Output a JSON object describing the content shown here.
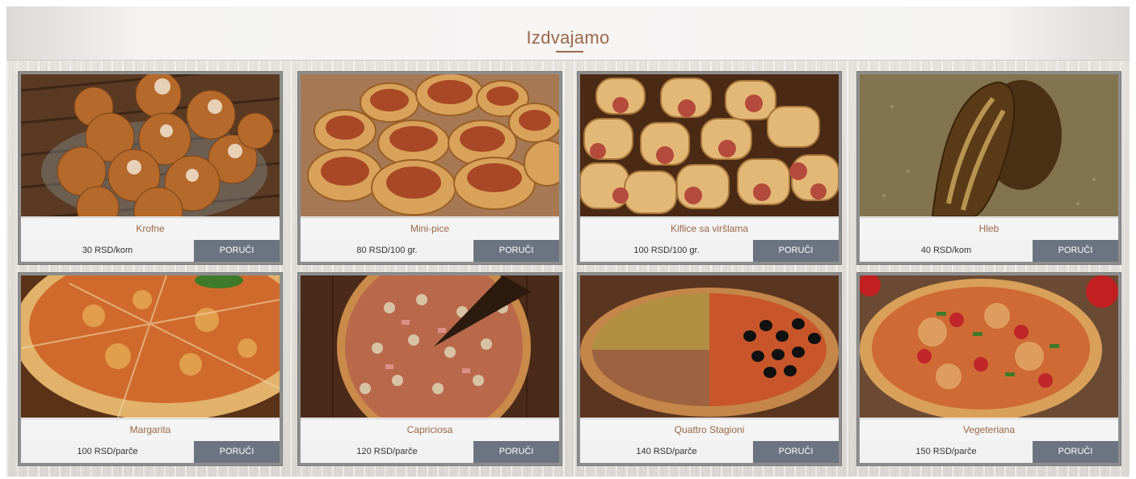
{
  "section": {
    "title": "Izdvajamo"
  },
  "products": [
    {
      "name": "Krofne",
      "price": "30 RSD/kom",
      "order_label": "PORUČI"
    },
    {
      "name": "Mini-pice",
      "price": "80 RSD/100 gr.",
      "order_label": "PORUČI"
    },
    {
      "name": "Kiflice sa viršlama",
      "price": "100 RSD/100 gr.",
      "order_label": "PORUČI"
    },
    {
      "name": "Hleb",
      "price": "40 RSD/kom",
      "order_label": "PORUČI"
    },
    {
      "name": "Margarita",
      "price": "100 RSD/parče",
      "order_label": "PORUČI"
    },
    {
      "name": "Capriciosa",
      "price": "120 RSD/parče",
      "order_label": "PORUČI"
    },
    {
      "name": "Quattro Stagioni",
      "price": "140 RSD/parče",
      "order_label": "PORUČI"
    },
    {
      "name": "Vegeteriana",
      "price": "150 RSD/parče",
      "order_label": "PORUČI"
    }
  ],
  "colors": {
    "accent": "#9a6748",
    "button_bg": "#6b7480",
    "button_text": "#ffffff"
  }
}
